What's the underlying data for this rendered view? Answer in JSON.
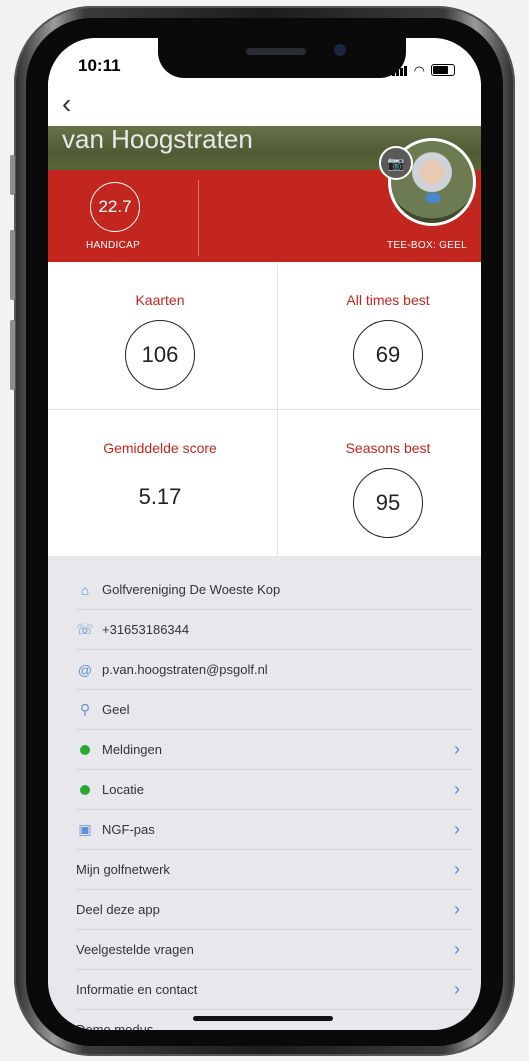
{
  "status": {
    "time": "10:11"
  },
  "profile": {
    "name": "van Hoogstraten",
    "handicap_value": "22.7",
    "handicap_label": "HANDICAP",
    "tee_box": "TEE-BOX: GEEL"
  },
  "stats": {
    "cards_label": "Kaarten",
    "cards_value": "106",
    "best_label": "All times best",
    "best_value": "69",
    "avg_label": "Gemiddelde score",
    "avg_value": "5.17",
    "season_label": "Seasons best",
    "season_value": "95"
  },
  "info": {
    "club": "Golfvereniging De Woeste Kop",
    "phone": "+31653186344",
    "email": "p.van.hoogstraten@psgolf.nl",
    "tee": "Geel"
  },
  "menu": {
    "notifications": "Meldingen",
    "location": "Locatie",
    "ngf_pass": "NGF-pas",
    "network": "Mijn golfnetwerk",
    "share": "Deel deze app",
    "faq": "Veelgestelde vragen",
    "contact": "Informatie en contact",
    "demo": "Demo modus"
  },
  "colors": {
    "accent_red": "#c3261f",
    "link_blue": "#5f8fd6",
    "status_green": "#2aa632"
  }
}
